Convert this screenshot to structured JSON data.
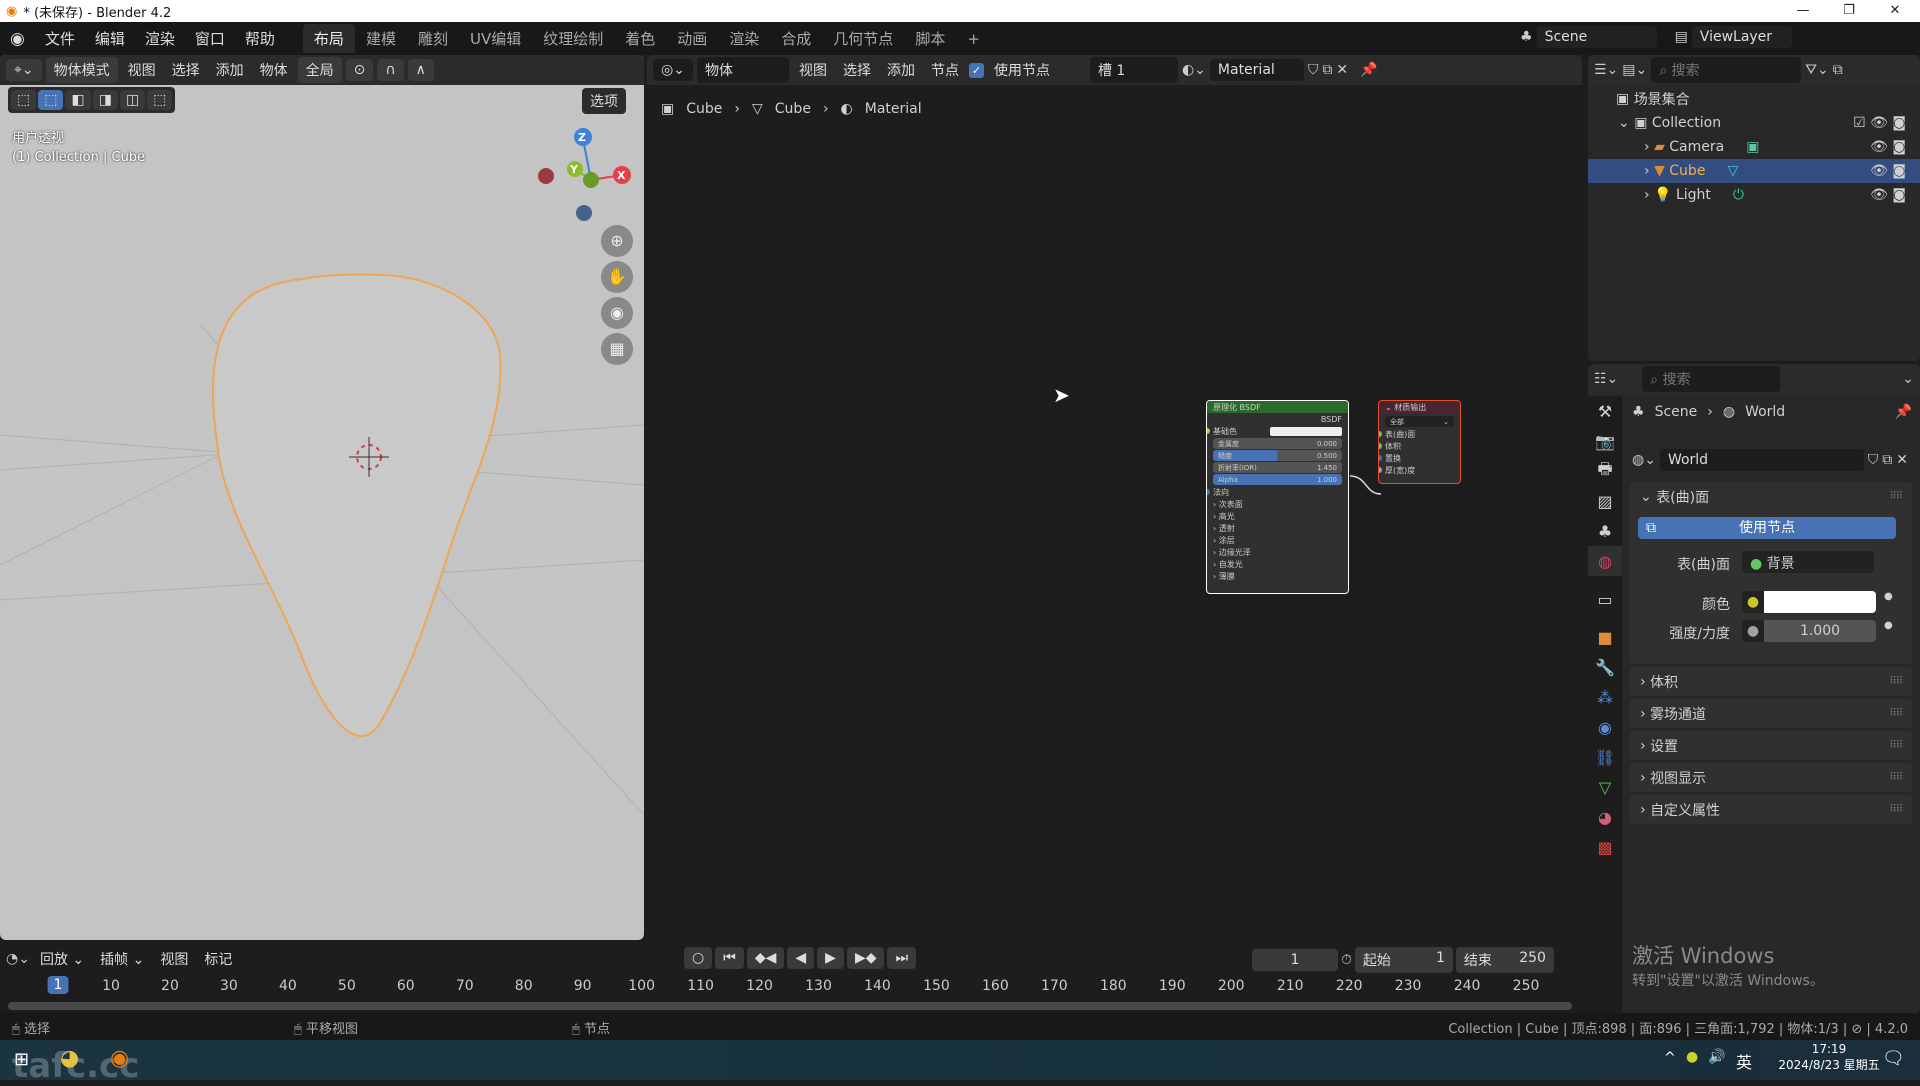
{
  "window": {
    "title": "* (未保存) - Blender 4.2",
    "minimize": "—",
    "maximize": "❐",
    "close": "✕"
  },
  "menubar": {
    "menus": [
      "文件",
      "编辑",
      "渲染",
      "窗口",
      "帮助"
    ],
    "workspaces": [
      "布局",
      "建模",
      "雕刻",
      "UV编辑",
      "纹理绘制",
      "着色",
      "动画",
      "渲染",
      "合成",
      "几何节点",
      "脚本",
      "+"
    ],
    "scene": "Scene",
    "view_layer": "ViewLayer"
  },
  "viewport": {
    "mode": "物体模式",
    "menus": [
      "视图",
      "选择",
      "添加",
      "物体"
    ],
    "orientation": "全局",
    "options": "选项",
    "overlay_title": "用户透视",
    "overlay_info": "(1) Collection | Cube",
    "gizmo": {
      "x": "X",
      "y": "Y",
      "z": "Z"
    },
    "colors": {
      "x": "#e3414a",
      "y": "#8cbd2c",
      "z": "#3d82d8",
      "selection": "#f0a455"
    }
  },
  "node_editor": {
    "type": "物体",
    "menus": [
      "视图",
      "选择",
      "添加",
      "节点"
    ],
    "use_nodes_label": "使用节点",
    "use_nodes": true,
    "slot": "槽 1",
    "material": "Material",
    "breadcrumb": [
      "Cube",
      "Cube",
      "Material"
    ],
    "bsdf_node": {
      "title": "原理化 BSDF",
      "output": "BSDF",
      "base_color": "基础色",
      "fields": [
        {
          "label": "金属度",
          "value": "0.000",
          "fill": 0
        },
        {
          "label": "糙度",
          "value": "0.500",
          "fill": 0.5
        },
        {
          "label": "折射率(IOR)",
          "value": "1.450",
          "fill": 0
        },
        {
          "label": "Alpha",
          "value": "1.000",
          "fill": 1
        }
      ],
      "normal": "法向",
      "sections": [
        "次表面",
        "高光",
        "透射",
        "涂层",
        "边缘光泽",
        "自发光",
        "薄膜"
      ]
    },
    "output_node": {
      "title": "材质输出",
      "target": "全部",
      "inputs": [
        "表(曲)面",
        "体积",
        "置换",
        "厚(宽)度"
      ]
    }
  },
  "outliner": {
    "search_placeholder": "搜索",
    "root": "场景集合",
    "collection": "Collection",
    "items": [
      {
        "name": "Camera",
        "selected": false
      },
      {
        "name": "Cube",
        "selected": true
      },
      {
        "name": "Light",
        "selected": false
      }
    ]
  },
  "properties": {
    "search_placeholder": "搜索",
    "breadcrumb": [
      "Scene",
      "World"
    ],
    "world": "World",
    "surface_panel": "表(曲)面",
    "use_nodes_button": "使用节点",
    "surface_label": "表(曲)面",
    "surface_value": "背景",
    "color_label": "颜色",
    "color_value": "#ffffff",
    "strength_label": "强度/力度",
    "strength_value": "1.000",
    "panels": [
      "体积",
      "雾场通道",
      "设置",
      "视图显示",
      "自定义属性"
    ]
  },
  "timeline": {
    "menus": [
      "回放",
      "插帧",
      "视图",
      "标记"
    ],
    "current_frame": "1",
    "start_label": "起始",
    "start": "1",
    "end_label": "结束",
    "end": "250",
    "ticks": [
      "1",
      "10",
      "20",
      "30",
      "40",
      "50",
      "60",
      "70",
      "80",
      "90",
      "100",
      "110",
      "120",
      "130",
      "140",
      "150",
      "160",
      "170",
      "180",
      "190",
      "200",
      "210",
      "220",
      "230",
      "240",
      "250"
    ]
  },
  "statusbar": {
    "left": "选择",
    "middle": "平移视图",
    "right": "节点",
    "stats": "Collection | Cube | 顶点:898 | 面:896 | 三角面:1,792 | 物体:1/3 |",
    "version": "4.2.0"
  },
  "watermark": {
    "title": "激活 Windows",
    "subtitle": "转到\"设置\"以激活 Windows。"
  },
  "taskbar": {
    "ime": "英",
    "time": "17:19",
    "date": "2024/8/23 星期五",
    "overlay_logo": "tafc.cc"
  }
}
